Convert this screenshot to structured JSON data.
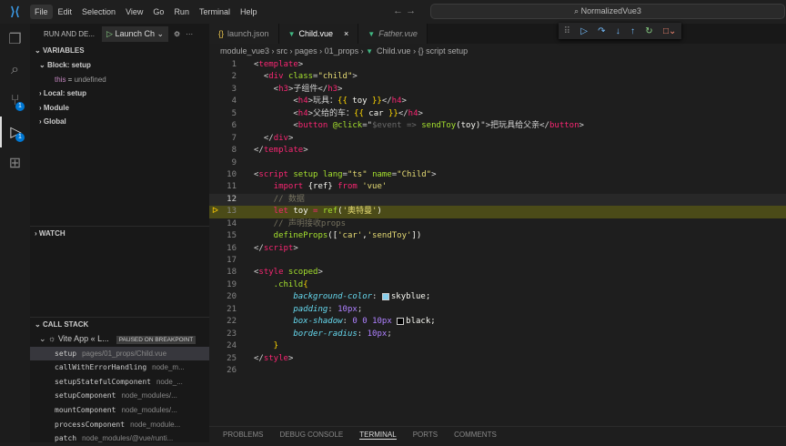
{
  "menu": [
    "File",
    "Edit",
    "Selection",
    "View",
    "Go",
    "Run",
    "Terminal",
    "Help"
  ],
  "search": "NormalizedVue3",
  "sidebar": {
    "title": "RUN AND DE...",
    "launch": "Launch Ch",
    "variables": "VARIABLES",
    "block": "Block: setup",
    "this_name": "this",
    "this_val": "undefined",
    "scopes": [
      "Local: setup",
      "Module",
      "Global"
    ],
    "watch": "WATCH",
    "callstack": "CALL STACK",
    "app": "Vite App « L...",
    "paused": "PAUSED ON BREAKPOINT",
    "frames": [
      [
        "setup",
        "pages/01_props/Child.vue"
      ],
      [
        "callWithErrorHandling",
        "node_m..."
      ],
      [
        "setupStatefulComponent",
        "node_..."
      ],
      [
        "setupComponent",
        "node_modules/..."
      ],
      [
        "mountComponent",
        "node_modules/..."
      ],
      [
        "processComponent",
        "node_module..."
      ],
      [
        "patch",
        "node_modules/@vue/runti..."
      ]
    ]
  },
  "badges": {
    "scm": "1",
    "debug": "1"
  },
  "tabs": [
    {
      "label": "launch.json",
      "icon": "json"
    },
    {
      "label": "Child.vue",
      "icon": "vue"
    },
    {
      "label": "Father.vue",
      "icon": "vue"
    }
  ],
  "breadcrumb": [
    "module_vue3",
    "src",
    "pages",
    "01_props",
    "Child.vue",
    "{} script setup"
  ],
  "code": [
    [
      [
        "p",
        "<"
      ],
      [
        "t",
        "template"
      ],
      [
        "p",
        ">"
      ]
    ],
    [
      [
        "p",
        "  <"
      ],
      [
        "t",
        "div"
      ],
      [
        "a",
        " class"
      ],
      [
        "p",
        "="
      ],
      [
        "s",
        "\"child\""
      ],
      [
        "p",
        ">"
      ]
    ],
    [
      [
        "p",
        "    <"
      ],
      [
        "t",
        "h3"
      ],
      [
        "p",
        ">子组件</"
      ],
      [
        "t",
        "h3"
      ],
      [
        "p",
        ">"
      ]
    ],
    [
      [
        "p",
        "        <"
      ],
      [
        "t",
        "h4"
      ],
      [
        "p",
        ">玩具："
      ],
      [
        "g",
        "{{"
      ],
      [
        "v",
        " toy "
      ],
      [
        "g",
        "}}"
      ],
      [
        "p",
        "</"
      ],
      [
        "t",
        "h4"
      ],
      [
        "p",
        ">"
      ]
    ],
    [
      [
        "p",
        "        <"
      ],
      [
        "t",
        "h4"
      ],
      [
        "p",
        ">父给的车："
      ],
      [
        "g",
        "{{"
      ],
      [
        "v",
        " car "
      ],
      [
        "g",
        "}}"
      ],
      [
        "p",
        "</"
      ],
      [
        "t",
        "h4"
      ],
      [
        "p",
        ">"
      ]
    ],
    [
      [
        "p",
        "        <"
      ],
      [
        "t",
        "button"
      ],
      [
        "a",
        " @click"
      ],
      [
        "p",
        "=\""
      ],
      [
        "i",
        "$event => "
      ],
      [
        "f",
        "sendToy"
      ],
      [
        "v",
        "(toy)"
      ],
      [
        "p",
        "\">把玩具给父亲</"
      ],
      [
        "t",
        "button"
      ],
      [
        "p",
        ">"
      ]
    ],
    [
      [
        "p",
        "  </"
      ],
      [
        "t",
        "div"
      ],
      [
        "p",
        ">"
      ]
    ],
    [
      [
        "p",
        "</"
      ],
      [
        "t",
        "template"
      ],
      [
        "p",
        ">"
      ]
    ],
    [],
    [
      [
        "p",
        "<"
      ],
      [
        "t",
        "script"
      ],
      [
        "a",
        " setup lang"
      ],
      [
        "p",
        "="
      ],
      [
        "s",
        "\"ts\""
      ],
      [
        "a",
        " name"
      ],
      [
        "p",
        "="
      ],
      [
        "s",
        "\"Child\""
      ],
      [
        "p",
        ">"
      ]
    ],
    [
      [
        "k",
        "    import "
      ],
      [
        "v",
        "{ref} "
      ],
      [
        "k",
        "from "
      ],
      [
        "s",
        "'vue'"
      ]
    ],
    [
      [
        "c",
        "    // 数据"
      ]
    ],
    [
      [
        "k",
        "    let "
      ],
      [
        "v",
        "toy "
      ],
      [
        "k",
        "= "
      ],
      [
        "f",
        "ref"
      ],
      [
        "v",
        "("
      ],
      [
        "s",
        "'奥特曼'"
      ],
      [
        "v",
        ")"
      ]
    ],
    [
      [
        "c",
        "    // 声明接收props"
      ]
    ],
    [
      [
        "f",
        "    defineProps"
      ],
      [
        "v",
        "(["
      ],
      [
        "s",
        "'car'"
      ],
      [
        "v",
        ","
      ],
      [
        "s",
        "'sendToy'"
      ],
      [
        "v",
        "])"
      ]
    ],
    [
      [
        "p",
        "</"
      ],
      [
        "t",
        "script"
      ],
      [
        "p",
        ">"
      ]
    ],
    [],
    [
      [
        "p",
        "<"
      ],
      [
        "t",
        "style"
      ],
      [
        "a",
        " scoped"
      ],
      [
        "p",
        ">"
      ]
    ],
    [
      [
        "a",
        "    .child"
      ],
      [
        "g",
        "{"
      ]
    ],
    [
      [
        "pr",
        "        background-color"
      ],
      [
        "p",
        ": "
      ],
      [
        "sw",
        "#87ceeb"
      ],
      [
        "v",
        "skyblue;"
      ]
    ],
    [
      [
        "pr",
        "        padding"
      ],
      [
        "p",
        ": "
      ],
      [
        "n",
        "10px"
      ],
      [
        "p",
        ";"
      ]
    ],
    [
      [
        "pr",
        "        box-shadow"
      ],
      [
        "p",
        ": "
      ],
      [
        "n",
        "0 0 10px "
      ],
      [
        "sw",
        "#000000"
      ],
      [
        "v",
        "black;"
      ]
    ],
    [
      [
        "pr",
        "        border-radius"
      ],
      [
        "p",
        ": "
      ],
      [
        "n",
        "10px"
      ],
      [
        "p",
        ";"
      ]
    ],
    [
      [
        "g",
        "    }"
      ]
    ],
    [
      [
        "p",
        "</"
      ],
      [
        "t",
        "style"
      ],
      [
        "p",
        ">"
      ]
    ],
    []
  ],
  "panel": [
    "PROBLEMS",
    "DEBUG CONSOLE",
    "TERMINAL",
    "PORTS",
    "COMMENTS"
  ]
}
